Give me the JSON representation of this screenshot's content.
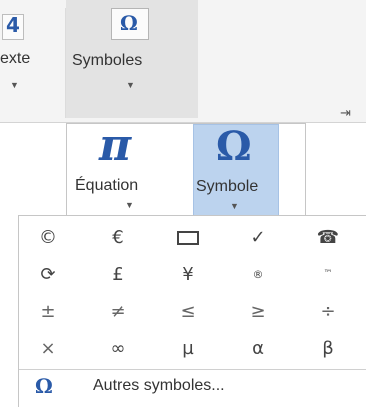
{
  "ribbon": {
    "texte_icon": "4",
    "texte_label": "exte",
    "symboles_icon": "Ω",
    "symboles_label": "Symboles",
    "caret": "▼",
    "pin": "⇥"
  },
  "dropdown": {
    "equation_icon": "π",
    "equation_label": "Équation",
    "symbol_icon": "Ω",
    "symbol_label": "Symbole",
    "caret": "▼"
  },
  "symbols": [
    [
      "©",
      "€",
      "",
      "✓",
      "☎"
    ],
    [
      "⟳",
      "£",
      "¥",
      "®",
      "™"
    ],
    [
      "±",
      "≠",
      "≤",
      "≥",
      "÷"
    ],
    [
      "×",
      "∞",
      "µ",
      "α",
      "β"
    ]
  ],
  "more": {
    "icon": "Ω",
    "label": "Autres symboles..."
  }
}
